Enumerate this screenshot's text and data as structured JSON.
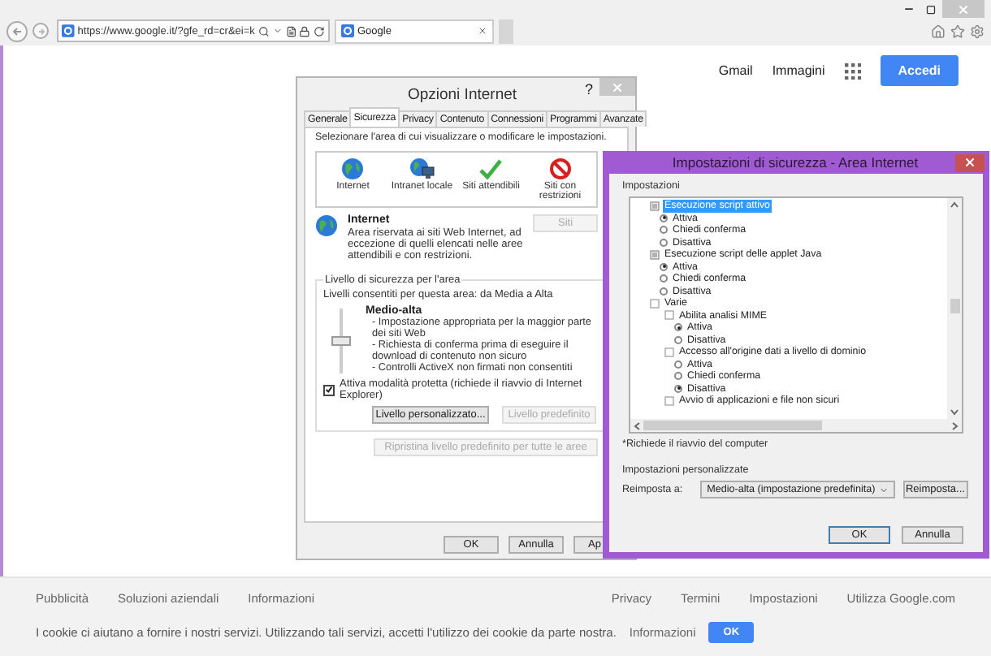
{
  "browser": {
    "address": "https://www.google.it/?gfe_rd=cr&ei=k",
    "tab": {
      "title": "Google"
    }
  },
  "page": {
    "header_links": [
      "Gmail",
      "Immagini"
    ],
    "sign_in": "Accedi"
  },
  "internet_options": {
    "title": "Opzioni Internet",
    "help": "?",
    "tabs": [
      {
        "label": "Generale",
        "selected": false
      },
      {
        "label": "Sicurezza",
        "selected": true
      },
      {
        "label": "Privacy",
        "selected": false
      },
      {
        "label": "Contenuto",
        "selected": false
      },
      {
        "label": "Connessioni",
        "selected": false
      },
      {
        "label": "Programmi",
        "selected": false
      },
      {
        "label": "Avanzate",
        "selected": false
      }
    ],
    "zone_prompt": "Selezionare l'area di cui visualizzare o modificare le impostazioni.",
    "zones": [
      {
        "label": "Internet",
        "kind": "globe"
      },
      {
        "label": "Intranet locale",
        "kind": "intranet"
      },
      {
        "label": "Siti attendibili",
        "kind": "trusted"
      },
      {
        "label": "Siti con restrizioni",
        "kind": "restricted"
      }
    ],
    "zone_title": "Internet",
    "zone_description": "Area riservata ai siti Web Internet, ad eccezione di quelli elencati nelle aree attendibili e con restrizioni.",
    "sites_button": {
      "label": "Siti",
      "disabled": true
    },
    "level_group": "Livello di sicurezza per l'area",
    "allowed_levels": "Livelli consentiti per questa area: da Media a Alta",
    "slider": {
      "level": 0.5
    },
    "level_name": "Medio-alta",
    "level_details": [
      "- Impostazione appropriata per la maggior parte dei siti Web",
      "- Richiesta di conferma prima di eseguire il download di contenuto non sicuro",
      "- Controlli ActiveX non firmati non consentiti"
    ],
    "protected_mode": {
      "label": "Attiva modalità protetta (richiede il riavvio di Internet Explorer)",
      "checked": true
    },
    "level_buttons": [
      {
        "label": "Livello personalizzato...",
        "disabled": false
      },
      {
        "label": "Livello predefinito",
        "disabled": true
      }
    ],
    "reset_all": {
      "label": "Ripristina livello predefinito per tutte le aree",
      "disabled": true
    },
    "footer_buttons": [
      "OK",
      "Annulla",
      "Ap"
    ]
  },
  "security_settings": {
    "title": "Impostazioni di sicurezza - Area Internet",
    "settings_label": "Impostazioni",
    "tree": [
      {
        "label": "Esecuzione script attivo",
        "kind": "setting",
        "selected": true,
        "children": [
          {
            "label": "Attiva",
            "kind": "radio",
            "checked": true
          },
          {
            "label": "Chiedi conferma",
            "kind": "radio",
            "checked": false
          },
          {
            "label": "Disattiva",
            "kind": "radio",
            "checked": false
          }
        ]
      },
      {
        "label": "Esecuzione script delle applet Java",
        "kind": "setting",
        "selected": false,
        "children": [
          {
            "label": "Attiva",
            "kind": "radio",
            "checked": true
          },
          {
            "label": "Chiedi conferma",
            "kind": "radio",
            "checked": false
          },
          {
            "label": "Disattiva",
            "kind": "radio",
            "checked": false
          }
        ]
      },
      {
        "label": "Varie",
        "kind": "category",
        "selected": false,
        "children": [
          {
            "label": "Abilita analisi MIME",
            "kind": "category",
            "selected": false,
            "children": [
              {
                "label": "Attiva",
                "kind": "radio",
                "checked": true
              },
              {
                "label": "Disattiva",
                "kind": "radio",
                "checked": false
              }
            ]
          },
          {
            "label": "Accesso all'origine dati a livello di dominio",
            "kind": "category",
            "selected": false,
            "children": [
              {
                "label": "Attiva",
                "kind": "radio",
                "checked": false
              },
              {
                "label": "Chiedi conferma",
                "kind": "radio",
                "checked": false
              },
              {
                "label": "Disattiva",
                "kind": "radio",
                "checked": true
              }
            ]
          },
          {
            "label": "Avvio di applicazioni e file non sicuri",
            "kind": "category",
            "selected": false
          }
        ]
      }
    ],
    "footnote": "*Richiede il riavvio del computer",
    "custom_label": "Impostazioni personalizzate",
    "reset_label": "Reimposta a:",
    "reset_value": "Medio-alta (impostazione predefinita)",
    "reset_button": "Reimposta...",
    "buttons": [
      "OK",
      "Annulla"
    ]
  },
  "footer": {
    "left_links": [
      "Pubblicità",
      "Soluzioni aziendali",
      "Informazioni"
    ],
    "right_links": [
      "Privacy",
      "Termini",
      "Impostazioni",
      "Utilizza Google.com"
    ],
    "cookie_notice": "I cookie ci aiutano a fornire i nostri servizi. Utilizzando tali servizi, accetti l'utilizzo dei cookie da parte nostra.",
    "cookie_link": "Informazioni",
    "cookie_ok": "OK"
  }
}
